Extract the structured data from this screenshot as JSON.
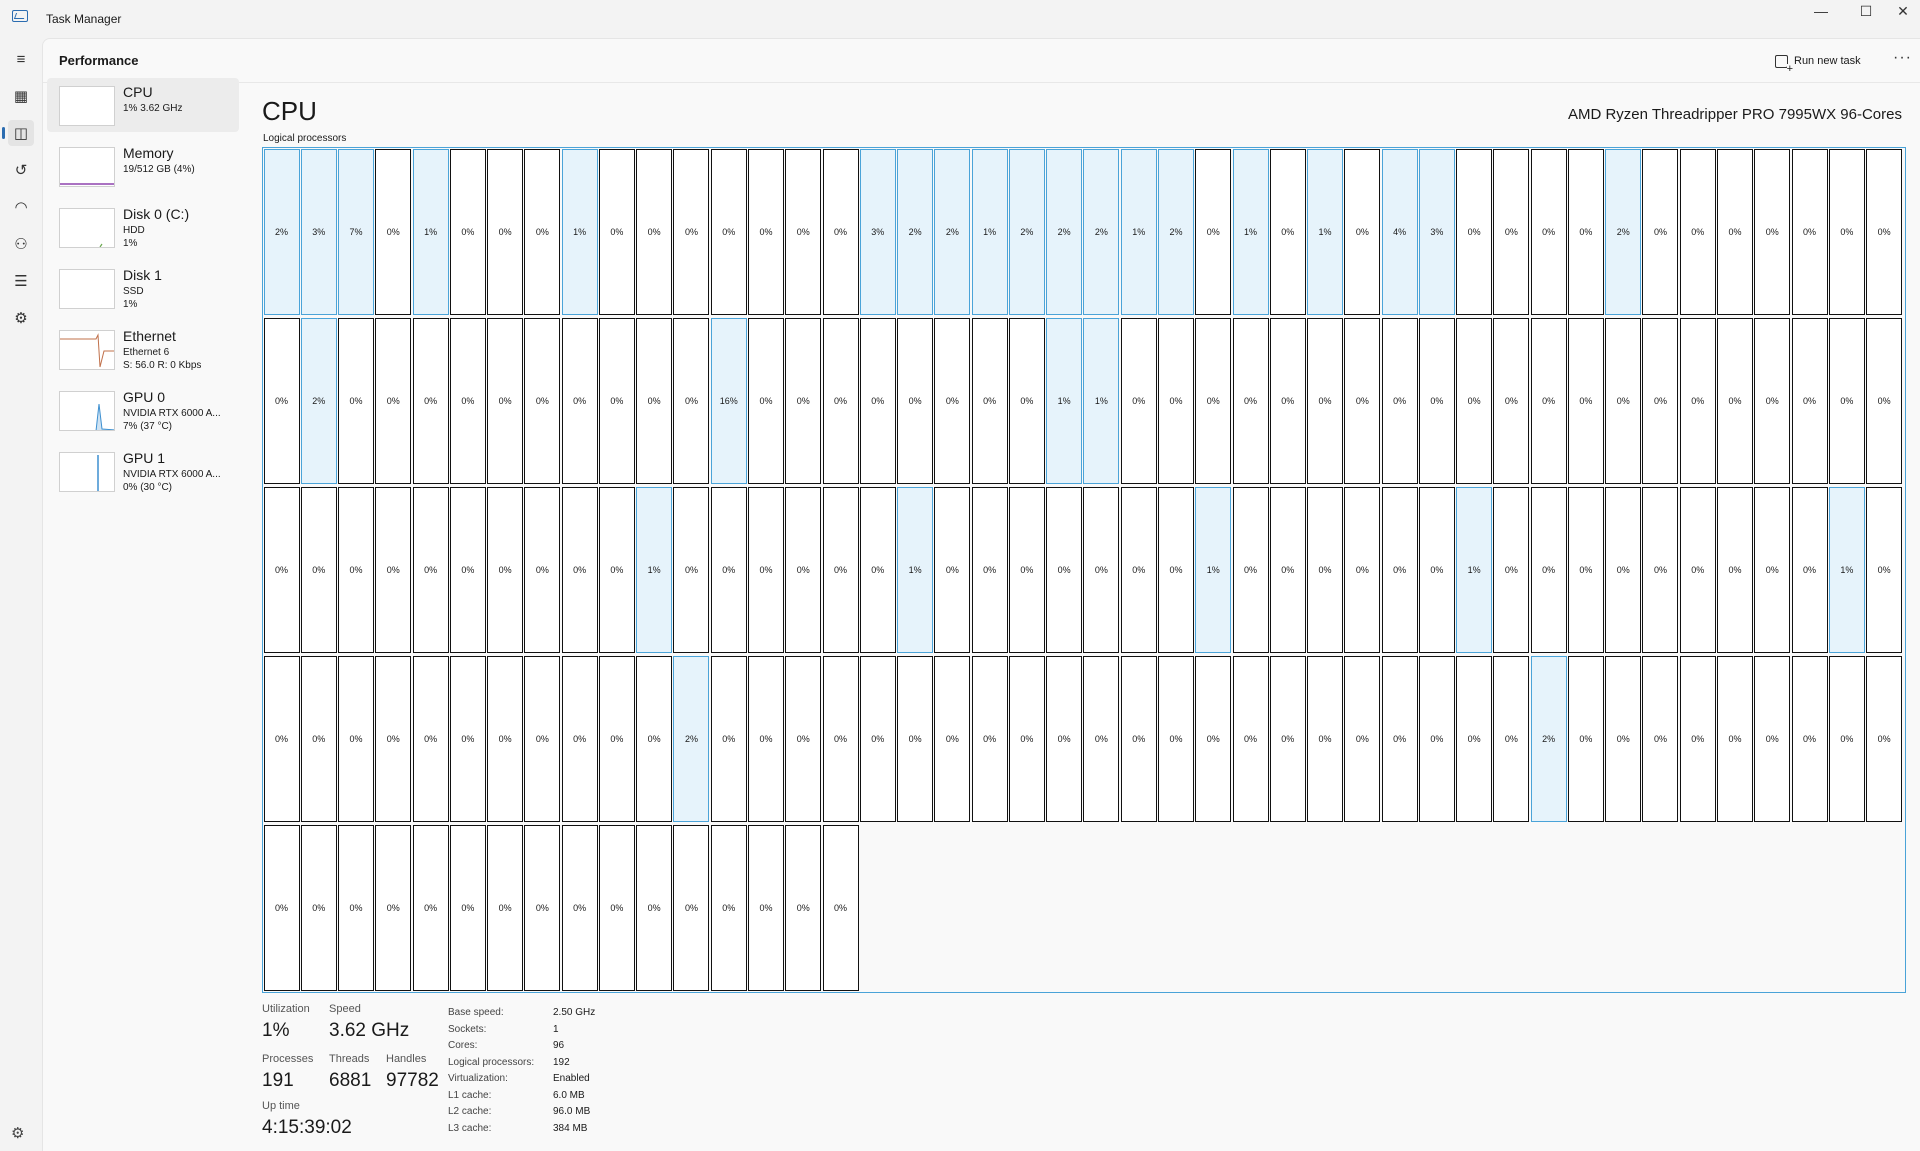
{
  "window": {
    "title": "Task Manager",
    "minimize_icon": "minimize-icon",
    "maximize_icon": "maximize-icon",
    "close_icon": "close-icon"
  },
  "nav_rail": [
    {
      "name": "hamburger-icon",
      "glyph": "≡"
    },
    {
      "name": "processes-icon",
      "glyph": "▦"
    },
    {
      "name": "performance-icon",
      "glyph": "◫",
      "active": true
    },
    {
      "name": "app-history-icon",
      "glyph": "↺"
    },
    {
      "name": "startup-apps-icon",
      "glyph": "◠"
    },
    {
      "name": "users-icon",
      "glyph": "⚇"
    },
    {
      "name": "details-icon",
      "glyph": "☰"
    },
    {
      "name": "services-icon",
      "glyph": "⚙"
    }
  ],
  "settings_icon": "⚙",
  "header": {
    "title": "Performance",
    "run_new_task": "Run new task",
    "more": "···"
  },
  "devices": [
    {
      "name": "CPU",
      "lines": [
        "1% 3.62 GHz"
      ],
      "selected": true
    },
    {
      "name": "Memory",
      "lines": [
        "19/512 GB (4%)"
      ]
    },
    {
      "name": "Disk 0 (C:)",
      "lines": [
        "HDD",
        "1%"
      ]
    },
    {
      "name": "Disk 1",
      "lines": [
        "SSD",
        "1%"
      ]
    },
    {
      "name": "Ethernet",
      "lines": [
        "Ethernet 6",
        "S: 56.0  R: 0 Kbps"
      ]
    },
    {
      "name": "GPU 0",
      "lines": [
        "NVIDIA RTX 6000 A...",
        "7% (37 °C)"
      ]
    },
    {
      "name": "GPU 1",
      "lines": [
        "NVIDIA RTX 6000 A...",
        "0% (30 °C)"
      ]
    }
  ],
  "colors": {
    "accent": "#2b6cb0",
    "graph_border": "#4aa3d8",
    "hot_cell": "#e6f3fb",
    "memory": "#8e44ad",
    "disk": "#6aa84f",
    "ethernet": "#c0704a",
    "gpu": "#3c8fd0"
  },
  "cpu": {
    "title": "CPU",
    "model": "AMD Ryzen Threadripper PRO 7995WX 96-Cores",
    "graph_label": "Logical processors",
    "processors": [
      "2%",
      "3%",
      "7%",
      "0%",
      "1%",
      "0%",
      "0%",
      "0%",
      "1%",
      "0%",
      "0%",
      "0%",
      "0%",
      "0%",
      "0%",
      "0%",
      "3%",
      "2%",
      "2%",
      "1%",
      "2%",
      "2%",
      "2%",
      "1%",
      "2%",
      "0%",
      "1%",
      "0%",
      "1%",
      "0%",
      "4%",
      "3%",
      "0%",
      "0%",
      "0%",
      "0%",
      "2%",
      "0%",
      "0%",
      "0%",
      "0%",
      "0%",
      "0%",
      "0%",
      "0%",
      "2%",
      "0%",
      "0%",
      "0%",
      "0%",
      "0%",
      "0%",
      "0%",
      "0%",
      "0%",
      "0%",
      "16%",
      "0%",
      "0%",
      "0%",
      "0%",
      "0%",
      "0%",
      "0%",
      "0%",
      "1%",
      "1%",
      "0%",
      "0%",
      "0%",
      "0%",
      "0%",
      "0%",
      "0%",
      "0%",
      "0%",
      "0%",
      "0%",
      "0%",
      "0%",
      "0%",
      "0%",
      "0%",
      "0%",
      "0%",
      "0%",
      "0%",
      "0%",
      "0%",
      "0%",
      "0%",
      "0%",
      "0%",
      "0%",
      "0%",
      "0%",
      "0%",
      "0%",
      "1%",
      "0%",
      "0%",
      "0%",
      "0%",
      "0%",
      "0%",
      "1%",
      "0%",
      "0%",
      "0%",
      "0%",
      "0%",
      "0%",
      "0%",
      "1%",
      "0%",
      "0%",
      "0%",
      "0%",
      "0%",
      "0%",
      "1%",
      "0%",
      "0%",
      "0%",
      "0%",
      "0%",
      "0%",
      "0%",
      "0%",
      "0%",
      "1%",
      "0%",
      "0%",
      "0%",
      "0%",
      "0%",
      "0%",
      "0%",
      "0%",
      "0%",
      "0%",
      "0%",
      "0%",
      "2%",
      "0%",
      "0%",
      "0%",
      "0%",
      "0%",
      "0%",
      "0%",
      "0%",
      "0%",
      "0%",
      "0%",
      "0%",
      "0%",
      "0%",
      "0%",
      "0%",
      "0%",
      "0%",
      "0%",
      "0%",
      "0%",
      "0%",
      "2%",
      "0%",
      "0%",
      "0%",
      "0%",
      "0%",
      "0%",
      "0%",
      "0%",
      "0%",
      "0%",
      "0%",
      "0%",
      "0%",
      "0%",
      "0%",
      "0%",
      "0%",
      "0%",
      "0%",
      "0%",
      "0%",
      "0%",
      "0%",
      "0%",
      "0%"
    ],
    "stats": {
      "utilization_label": "Utilization",
      "utilization": "1%",
      "speed_label": "Speed",
      "speed": "3.62 GHz",
      "processes_label": "Processes",
      "processes": "191",
      "threads_label": "Threads",
      "threads": "6881",
      "handles_label": "Handles",
      "handles": "97782",
      "uptime_label": "Up time",
      "uptime": "4:15:39:02"
    },
    "specs": [
      {
        "label": "Base speed:",
        "value": "2.50 GHz"
      },
      {
        "label": "Sockets:",
        "value": "1"
      },
      {
        "label": "Cores:",
        "value": "96"
      },
      {
        "label": "Logical processors:",
        "value": "192"
      },
      {
        "label": "Virtualization:",
        "value": "Enabled"
      },
      {
        "label": "L1 cache:",
        "value": "6.0 MB"
      },
      {
        "label": "L2 cache:",
        "value": "96.0 MB"
      },
      {
        "label": "L3 cache:",
        "value": "384 MB"
      }
    ]
  }
}
